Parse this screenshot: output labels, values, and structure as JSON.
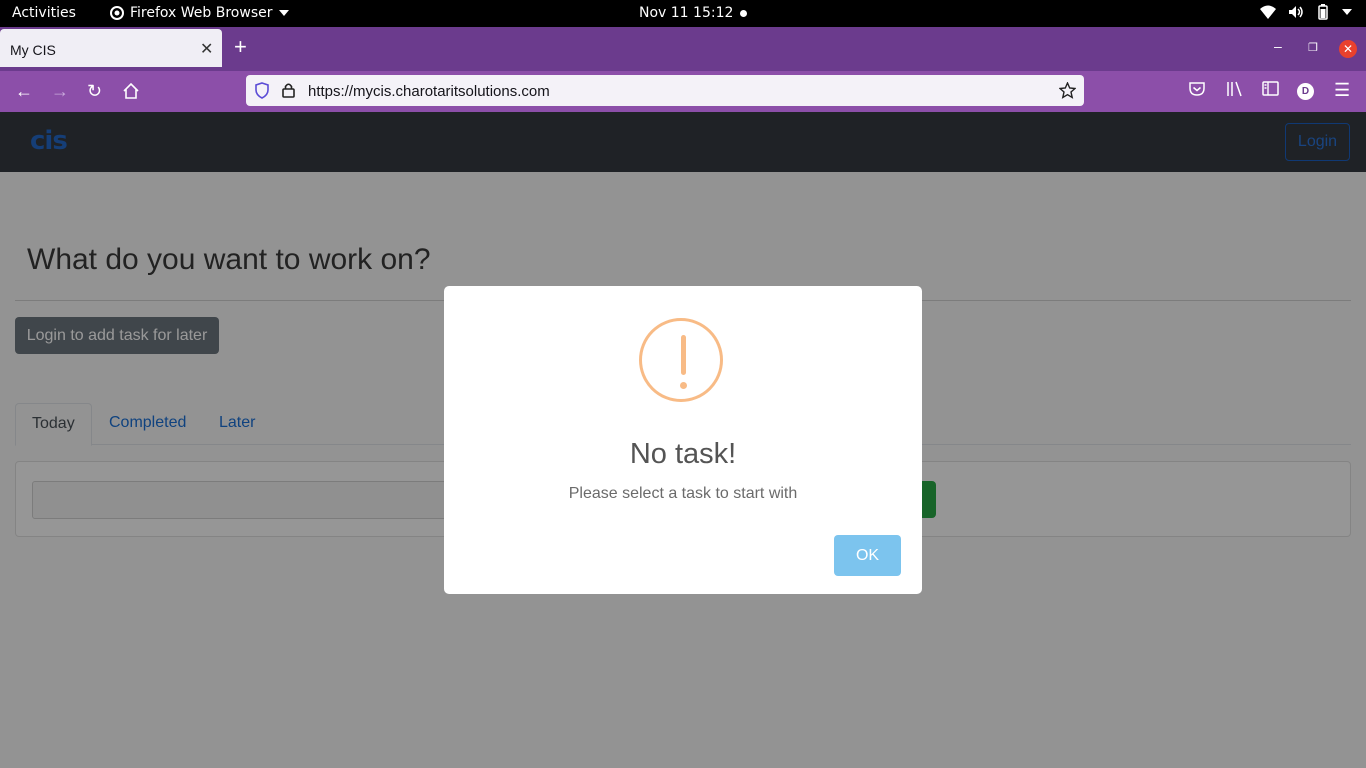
{
  "system": {
    "activities": "Activities",
    "app_menu": "Firefox Web Browser",
    "clock": "Nov 11  15:12"
  },
  "browser": {
    "tab_title": "My CIS",
    "url_host": "https://mycis.charotaritsolutions.com",
    "profile_initial": "D"
  },
  "site": {
    "logo": "cis",
    "login_label": "Login",
    "heading": "What do you want to work on?",
    "add_later_label": "Login to add task for later",
    "tabs": [
      {
        "label": "Today",
        "active": true
      },
      {
        "label": "Completed",
        "active": false
      },
      {
        "label": "Later",
        "active": false
      }
    ]
  },
  "modal": {
    "icon": "warning-icon",
    "title": "No task!",
    "text": "Please select a task to start with",
    "ok_label": "OK"
  },
  "colors": {
    "tab_strip": "#6b3b8d",
    "nav_bar": "#8c4fa9",
    "warning": "#f8bb86",
    "ok_button": "#7cc4ee"
  }
}
